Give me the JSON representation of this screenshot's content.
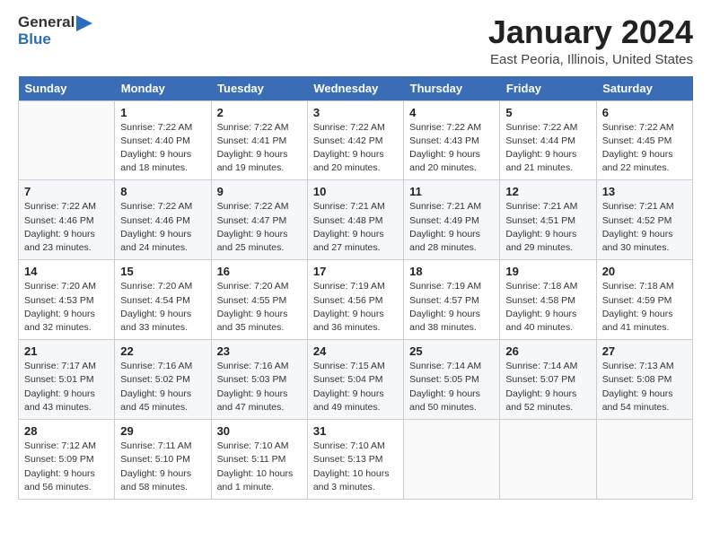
{
  "logo": {
    "general": "General",
    "blue": "Blue"
  },
  "header": {
    "title": "January 2024",
    "subtitle": "East Peoria, Illinois, United States"
  },
  "calendar": {
    "days_of_week": [
      "Sunday",
      "Monday",
      "Tuesday",
      "Wednesday",
      "Thursday",
      "Friday",
      "Saturday"
    ],
    "weeks": [
      [
        {
          "day": "",
          "sunrise": "",
          "sunset": "",
          "daylight": ""
        },
        {
          "day": "1",
          "sunrise": "Sunrise: 7:22 AM",
          "sunset": "Sunset: 4:40 PM",
          "daylight": "Daylight: 9 hours and 18 minutes."
        },
        {
          "day": "2",
          "sunrise": "Sunrise: 7:22 AM",
          "sunset": "Sunset: 4:41 PM",
          "daylight": "Daylight: 9 hours and 19 minutes."
        },
        {
          "day": "3",
          "sunrise": "Sunrise: 7:22 AM",
          "sunset": "Sunset: 4:42 PM",
          "daylight": "Daylight: 9 hours and 20 minutes."
        },
        {
          "day": "4",
          "sunrise": "Sunrise: 7:22 AM",
          "sunset": "Sunset: 4:43 PM",
          "daylight": "Daylight: 9 hours and 20 minutes."
        },
        {
          "day": "5",
          "sunrise": "Sunrise: 7:22 AM",
          "sunset": "Sunset: 4:44 PM",
          "daylight": "Daylight: 9 hours and 21 minutes."
        },
        {
          "day": "6",
          "sunrise": "Sunrise: 7:22 AM",
          "sunset": "Sunset: 4:45 PM",
          "daylight": "Daylight: 9 hours and 22 minutes."
        }
      ],
      [
        {
          "day": "7",
          "sunrise": "Sunrise: 7:22 AM",
          "sunset": "Sunset: 4:46 PM",
          "daylight": "Daylight: 9 hours and 23 minutes."
        },
        {
          "day": "8",
          "sunrise": "Sunrise: 7:22 AM",
          "sunset": "Sunset: 4:46 PM",
          "daylight": "Daylight: 9 hours and 24 minutes."
        },
        {
          "day": "9",
          "sunrise": "Sunrise: 7:22 AM",
          "sunset": "Sunset: 4:47 PM",
          "daylight": "Daylight: 9 hours and 25 minutes."
        },
        {
          "day": "10",
          "sunrise": "Sunrise: 7:21 AM",
          "sunset": "Sunset: 4:48 PM",
          "daylight": "Daylight: 9 hours and 27 minutes."
        },
        {
          "day": "11",
          "sunrise": "Sunrise: 7:21 AM",
          "sunset": "Sunset: 4:49 PM",
          "daylight": "Daylight: 9 hours and 28 minutes."
        },
        {
          "day": "12",
          "sunrise": "Sunrise: 7:21 AM",
          "sunset": "Sunset: 4:51 PM",
          "daylight": "Daylight: 9 hours and 29 minutes."
        },
        {
          "day": "13",
          "sunrise": "Sunrise: 7:21 AM",
          "sunset": "Sunset: 4:52 PM",
          "daylight": "Daylight: 9 hours and 30 minutes."
        }
      ],
      [
        {
          "day": "14",
          "sunrise": "Sunrise: 7:20 AM",
          "sunset": "Sunset: 4:53 PM",
          "daylight": "Daylight: 9 hours and 32 minutes."
        },
        {
          "day": "15",
          "sunrise": "Sunrise: 7:20 AM",
          "sunset": "Sunset: 4:54 PM",
          "daylight": "Daylight: 9 hours and 33 minutes."
        },
        {
          "day": "16",
          "sunrise": "Sunrise: 7:20 AM",
          "sunset": "Sunset: 4:55 PM",
          "daylight": "Daylight: 9 hours and 35 minutes."
        },
        {
          "day": "17",
          "sunrise": "Sunrise: 7:19 AM",
          "sunset": "Sunset: 4:56 PM",
          "daylight": "Daylight: 9 hours and 36 minutes."
        },
        {
          "day": "18",
          "sunrise": "Sunrise: 7:19 AM",
          "sunset": "Sunset: 4:57 PM",
          "daylight": "Daylight: 9 hours and 38 minutes."
        },
        {
          "day": "19",
          "sunrise": "Sunrise: 7:18 AM",
          "sunset": "Sunset: 4:58 PM",
          "daylight": "Daylight: 9 hours and 40 minutes."
        },
        {
          "day": "20",
          "sunrise": "Sunrise: 7:18 AM",
          "sunset": "Sunset: 4:59 PM",
          "daylight": "Daylight: 9 hours and 41 minutes."
        }
      ],
      [
        {
          "day": "21",
          "sunrise": "Sunrise: 7:17 AM",
          "sunset": "Sunset: 5:01 PM",
          "daylight": "Daylight: 9 hours and 43 minutes."
        },
        {
          "day": "22",
          "sunrise": "Sunrise: 7:16 AM",
          "sunset": "Sunset: 5:02 PM",
          "daylight": "Daylight: 9 hours and 45 minutes."
        },
        {
          "day": "23",
          "sunrise": "Sunrise: 7:16 AM",
          "sunset": "Sunset: 5:03 PM",
          "daylight": "Daylight: 9 hours and 47 minutes."
        },
        {
          "day": "24",
          "sunrise": "Sunrise: 7:15 AM",
          "sunset": "Sunset: 5:04 PM",
          "daylight": "Daylight: 9 hours and 49 minutes."
        },
        {
          "day": "25",
          "sunrise": "Sunrise: 7:14 AM",
          "sunset": "Sunset: 5:05 PM",
          "daylight": "Daylight: 9 hours and 50 minutes."
        },
        {
          "day": "26",
          "sunrise": "Sunrise: 7:14 AM",
          "sunset": "Sunset: 5:07 PM",
          "daylight": "Daylight: 9 hours and 52 minutes."
        },
        {
          "day": "27",
          "sunrise": "Sunrise: 7:13 AM",
          "sunset": "Sunset: 5:08 PM",
          "daylight": "Daylight: 9 hours and 54 minutes."
        }
      ],
      [
        {
          "day": "28",
          "sunrise": "Sunrise: 7:12 AM",
          "sunset": "Sunset: 5:09 PM",
          "daylight": "Daylight: 9 hours and 56 minutes."
        },
        {
          "day": "29",
          "sunrise": "Sunrise: 7:11 AM",
          "sunset": "Sunset: 5:10 PM",
          "daylight": "Daylight: 9 hours and 58 minutes."
        },
        {
          "day": "30",
          "sunrise": "Sunrise: 7:10 AM",
          "sunset": "Sunset: 5:11 PM",
          "daylight": "Daylight: 10 hours and 1 minute."
        },
        {
          "day": "31",
          "sunrise": "Sunrise: 7:10 AM",
          "sunset": "Sunset: 5:13 PM",
          "daylight": "Daylight: 10 hours and 3 minutes."
        },
        {
          "day": "",
          "sunrise": "",
          "sunset": "",
          "daylight": ""
        },
        {
          "day": "",
          "sunrise": "",
          "sunset": "",
          "daylight": ""
        },
        {
          "day": "",
          "sunrise": "",
          "sunset": "",
          "daylight": ""
        }
      ]
    ]
  }
}
